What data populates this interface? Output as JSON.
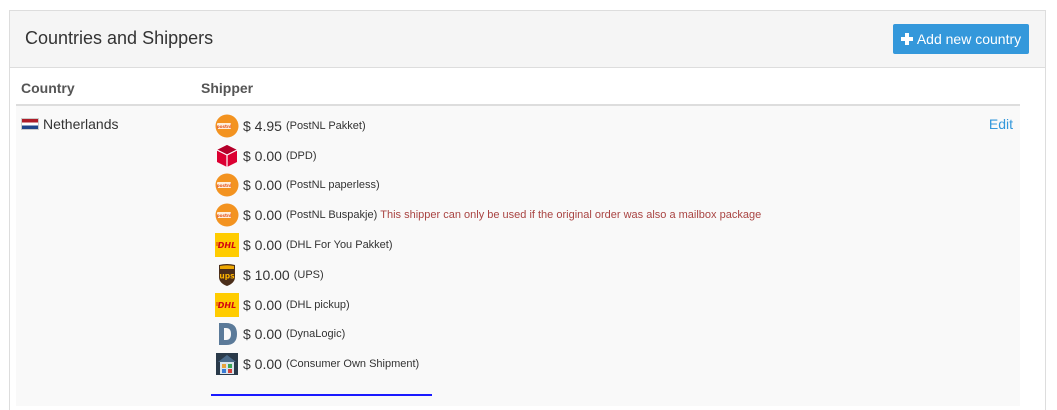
{
  "header": {
    "title": "Countries and Shippers",
    "add_button_label": "Add new country"
  },
  "table": {
    "columns": {
      "country": "Country",
      "shipper": "Shipper"
    },
    "rows": [
      {
        "country": "Netherlands",
        "edit_label": "Edit",
        "shippers": [
          {
            "logo": "postnl-logo",
            "price": "$ 4.95",
            "name": "(PostNL Pakket)",
            "note": ""
          },
          {
            "logo": "dpd-logo",
            "price": "$ 0.00",
            "name": "(DPD)",
            "note": ""
          },
          {
            "logo": "postnl-logo",
            "price": "$ 0.00",
            "name": "(PostNL paperless)",
            "note": ""
          },
          {
            "logo": "postnl-logo",
            "price": "$ 0.00",
            "name": "(PostNL Buspakje)",
            "note": "This shipper can only be used if the original order was also a mailbox package"
          },
          {
            "logo": "dhl-logo",
            "price": "$ 0.00",
            "name": "(DHL For You Pakket)",
            "note": ""
          },
          {
            "logo": "ups-logo",
            "price": "$ 10.00",
            "name": "(UPS)",
            "note": ""
          },
          {
            "logo": "dhl-logo",
            "price": "$ 0.00",
            "name": "(DHL pickup)",
            "note": ""
          },
          {
            "logo": "dynalogic-logo",
            "price": "$ 0.00",
            "name": "(DynaLogic)",
            "note": ""
          },
          {
            "logo": "own-shipment-logo",
            "price": "$ 0.00",
            "name": "(Consumer Own Shipment)",
            "note": ""
          }
        ]
      }
    ]
  },
  "colors": {
    "accent": "#3498db",
    "warning_text": "#a94442",
    "underline": "#1a1aff"
  }
}
